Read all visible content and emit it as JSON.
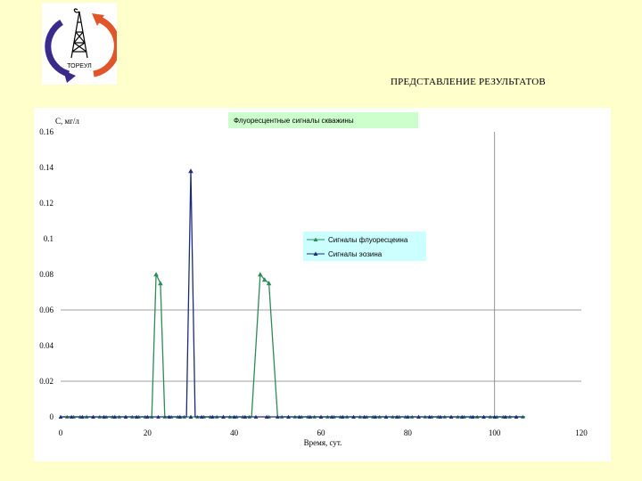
{
  "slide": {
    "title": "ПРЕДСТАВЛЕНИЕ РЕЗУЛЬТАТОВ",
    "logo_text": "ТОРЕУЛ",
    "logo_colors": {
      "left_arc": "#3a2a8c",
      "right_arc": "#e0552a",
      "rig": "#000000"
    }
  },
  "chart_data": {
    "type": "line",
    "title": "Флуоресцентные сигналы скважины",
    "ylabel": "C, мг/л",
    "xlabel": "Время, сут.",
    "xlim": [
      0,
      120
    ],
    "ylim": [
      0,
      0.16
    ],
    "x_ticks": [
      "0",
      "20",
      "40",
      "60",
      "80",
      "100",
      "120"
    ],
    "y_ticks": [
      "0",
      "0.02",
      "0.04",
      "0.06",
      "0.08",
      "0.1",
      "0.12",
      "0.14",
      "0.16"
    ],
    "grid": {
      "horizontal_at": [
        0.02,
        0.06
      ],
      "vertical_at": [
        100
      ]
    },
    "legend_position": "center-right",
    "series": [
      {
        "name": "Сигналы флуоресцеина",
        "color": "#2e8b57",
        "x": [
          0,
          21,
          22,
          23,
          24,
          25,
          44,
          46,
          47,
          48,
          50,
          107
        ],
        "y": [
          0,
          0,
          0.08,
          0.075,
          0,
          0,
          0,
          0.08,
          0.077,
          0.075,
          0,
          0
        ]
      },
      {
        "name": "Сигналы эозина",
        "color": "#1f2b7a",
        "x": [
          0,
          29,
          30,
          31,
          107
        ],
        "y": [
          0,
          0,
          0.138,
          0,
          0
        ]
      }
    ]
  }
}
